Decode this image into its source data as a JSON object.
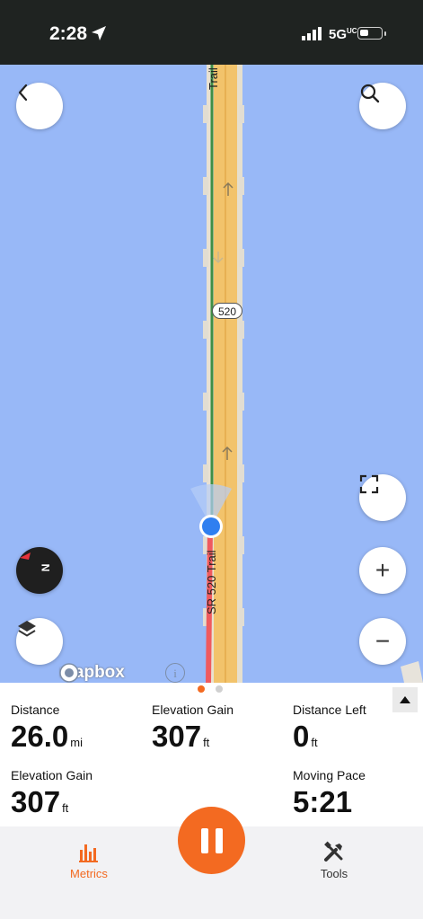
{
  "status_bar": {
    "time": "2:28",
    "network": "5G",
    "network_suffix": "UC"
  },
  "map": {
    "route_shield": "520",
    "trail_label_top": "Trail",
    "trail_label_main": "SR 520 Trail",
    "attribution": "mapbox",
    "info_symbol": "i",
    "colors": {
      "water": "#98b8f7",
      "road": "#f2c36b",
      "track_ahead": "#3f8f46",
      "track_behind": "#ef5a5f",
      "location": "#2f7ff0"
    }
  },
  "controls": {
    "back_icon": "chevron-left-icon",
    "search_icon": "search-icon",
    "fullscreen_icon": "fullscreen-icon",
    "zoom_in": "+",
    "zoom_out": "−",
    "compass_letter": "N",
    "layers_icon": "layers-icon"
  },
  "metrics": {
    "page_indicator": {
      "pages": 2,
      "active": 1
    },
    "items": [
      {
        "label": "Distance",
        "value": "26.0",
        "unit": "mi"
      },
      {
        "label": "Elevation Gain",
        "value": "307",
        "unit": "ft"
      },
      {
        "label": "Distance Left",
        "value": "0",
        "unit": "ft"
      },
      {
        "label": "Elevation Gain",
        "value": "307",
        "unit": "ft"
      },
      {
        "label": "Moving Pace",
        "value": "5:21",
        "unit": ""
      }
    ]
  },
  "tabbar": {
    "metrics_label": "Metrics",
    "tools_label": "Tools",
    "accent": "#f36a21"
  }
}
